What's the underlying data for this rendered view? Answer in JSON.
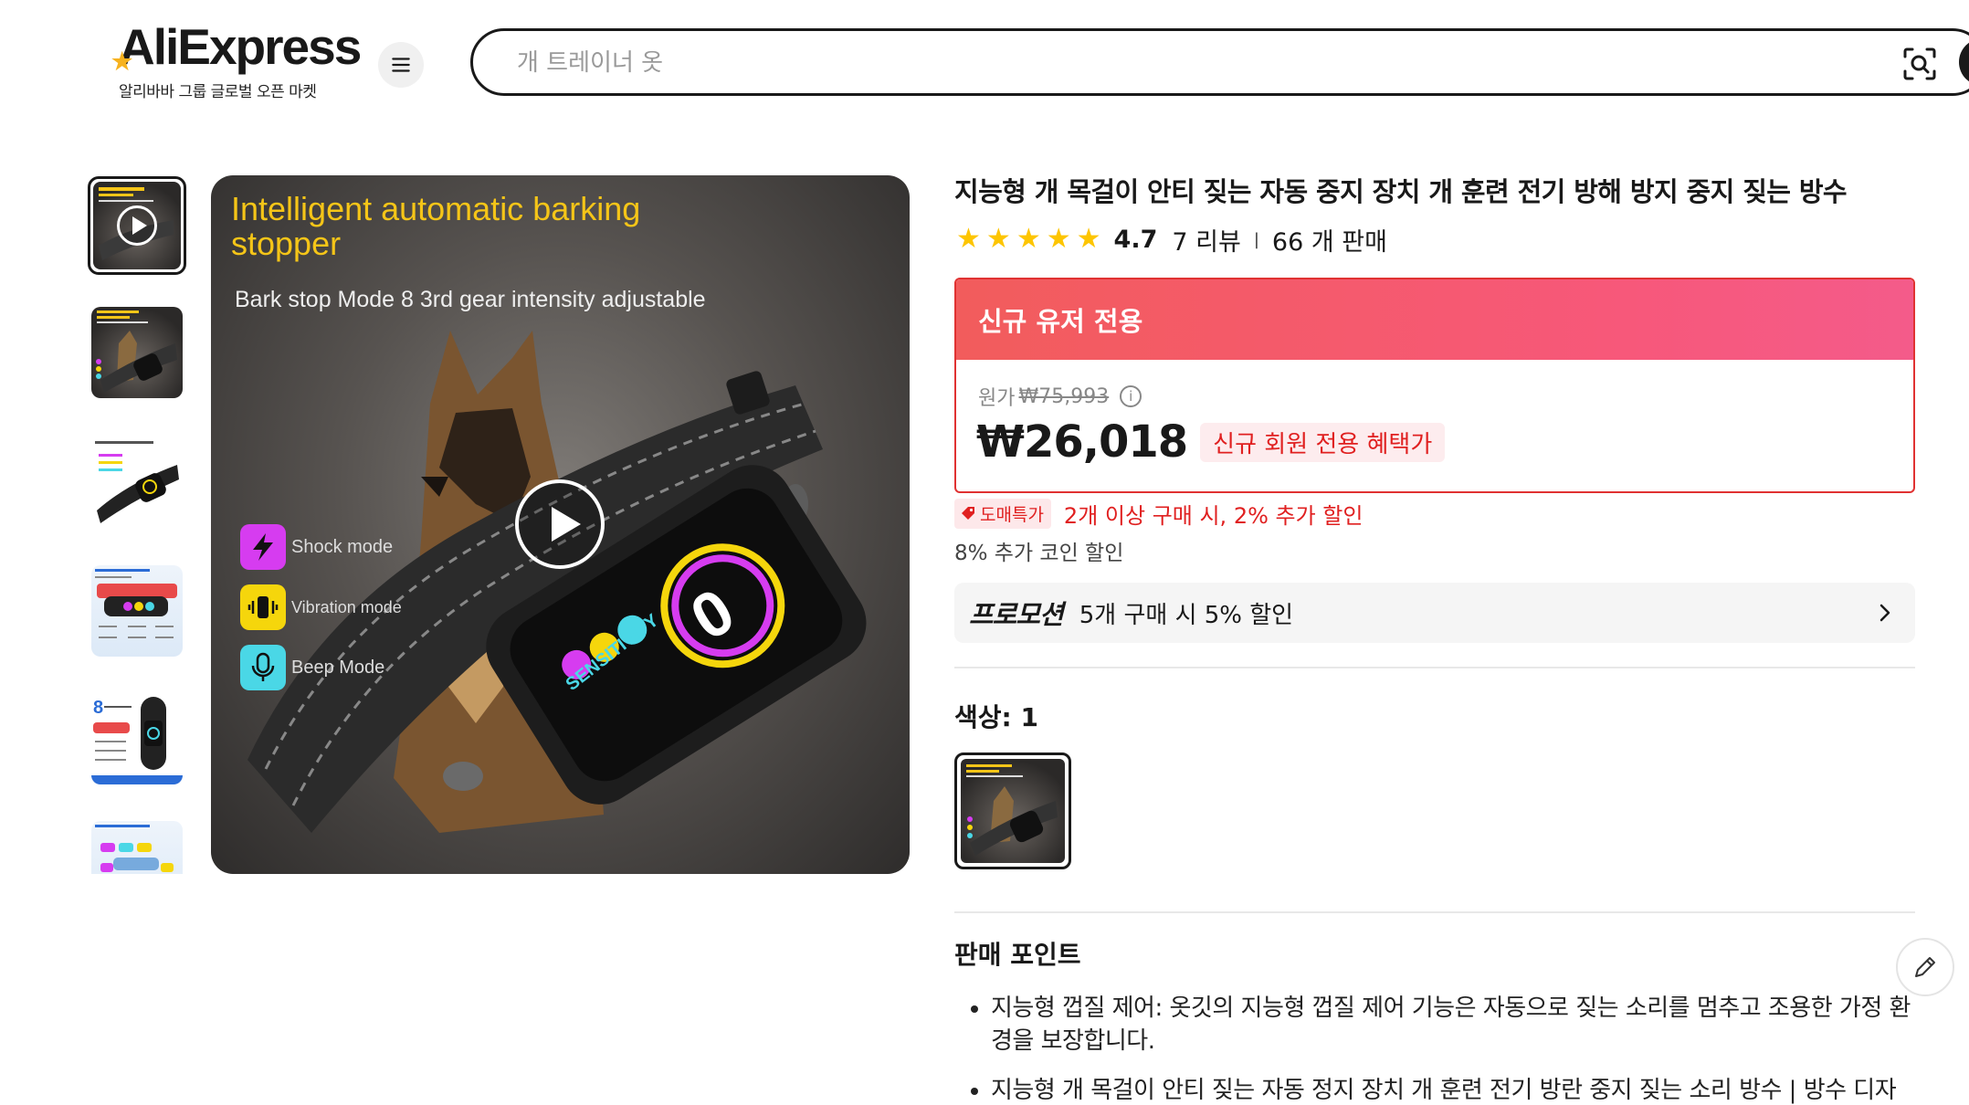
{
  "header": {
    "logo_text": "AliExpress",
    "logo_sub": "알리바바 그룹 글로벌 오픈 마켓",
    "search_placeholder": "개 트레이너 옷"
  },
  "gallery": {
    "main_title": "Intelligent automatic barking stopper",
    "main_subtitle": "Bark stop Mode 8 3rd gear intensity adjustable",
    "modes": [
      {
        "label": "Shock mode",
        "color": "#d63cf0"
      },
      {
        "label": "Vibration mode",
        "color": "#f5d60c"
      },
      {
        "label": "Beep Mode",
        "color": "#4ad7e6"
      }
    ],
    "device_text": "SENSITIVITY"
  },
  "product": {
    "title": "지능형 개 목걸이 안티 짖는 자동 중지 장치 개 훈련 전기 방해 방지 중지 짖는 방수",
    "rating": "4.7",
    "reviews": "7 리뷰",
    "sold": "66 개 판매"
  },
  "deal": {
    "header": "신규 유저 전용",
    "original_label": "원가",
    "original_price": "₩75,993",
    "price": "₩26,018",
    "badge": "신규 회원 전용 혜택가"
  },
  "bulk": {
    "tag": "도매특가",
    "text": "2개 이상 구매 시, 2% 추가 할인"
  },
  "coin_text": "8% 추가 코인 할인",
  "promotion": {
    "label": "프로모션",
    "text": "5개 구매 시 5% 할인"
  },
  "color": {
    "label": "색상: 1"
  },
  "selling_points": {
    "title": "판매 포인트",
    "items": [
      "지능형 껍질 제어: 옷깃의 지능형 껍질 제어 기능은 자동으로 짖는 소리를 멈추고 조용한 가정 환경을 보장합니다.",
      "지능형 개 목걸이 안티 짖는 자동 정지 장치 개 훈련 전기 방란 중지 짖는 소리 방수 | 방수 디자인: 이 칼라는 방수 설계되어 야외 사용 및 수영 활동에 적합합니다."
    ]
  }
}
